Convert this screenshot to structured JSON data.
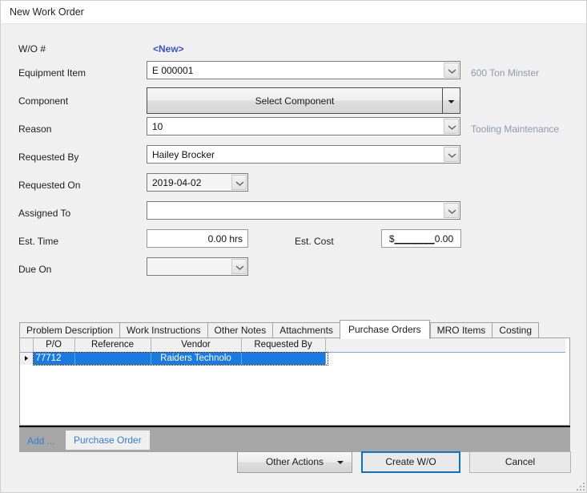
{
  "window": {
    "title": "New Work Order"
  },
  "form": {
    "wo_number": {
      "label": "W/O #",
      "value": "<New>"
    },
    "equipment_item": {
      "label": "Equipment Item",
      "value": "E 000001",
      "side_note": "600 Ton Minster"
    },
    "component": {
      "label": "Component",
      "button_label": "Select Component"
    },
    "reason": {
      "label": "Reason",
      "value": "10",
      "side_note": "Tooling Maintenance"
    },
    "requested_by": {
      "label": "Requested By",
      "value": "Hailey Brocker"
    },
    "requested_on": {
      "label": "Requested On",
      "value": "2019-04-02"
    },
    "assigned_to": {
      "label": "Assigned To",
      "value": ""
    },
    "est_time": {
      "label": "Est. Time",
      "value": "0.00 hrs"
    },
    "est_cost": {
      "label": "Est. Cost",
      "currency": "$",
      "mask": "_______",
      "value": "0.00"
    },
    "due_on": {
      "label": "Due On",
      "value": ""
    }
  },
  "tabs": [
    {
      "label": "Problem Description",
      "active": false
    },
    {
      "label": "Work Instructions",
      "active": false
    },
    {
      "label": "Other Notes",
      "active": false
    },
    {
      "label": "Attachments",
      "active": false
    },
    {
      "label": "Purchase Orders",
      "active": true
    },
    {
      "label": "MRO Items",
      "active": false
    },
    {
      "label": "Costing",
      "active": false
    }
  ],
  "grid": {
    "columns": [
      "P/O",
      "Reference",
      "Vendor",
      "Requested By"
    ],
    "rows": [
      {
        "selected": true,
        "cells": [
          "77712",
          "",
          "Raiders Technolo",
          ""
        ]
      }
    ]
  },
  "addbar": {
    "add_label": "Add ...",
    "purchase_order_label": "Purchase Order"
  },
  "footer": {
    "other_actions_label": "Other Actions",
    "create_wo_label": "Create W/O",
    "cancel_label": "Cancel"
  },
  "colors": {
    "accent_blue": "#3a53c8",
    "link_blue": "#2f7fd0",
    "selection_blue": "#1a7ae0",
    "default_button_border": "#0a73c6",
    "side_note_gray": "#8d9aab"
  }
}
